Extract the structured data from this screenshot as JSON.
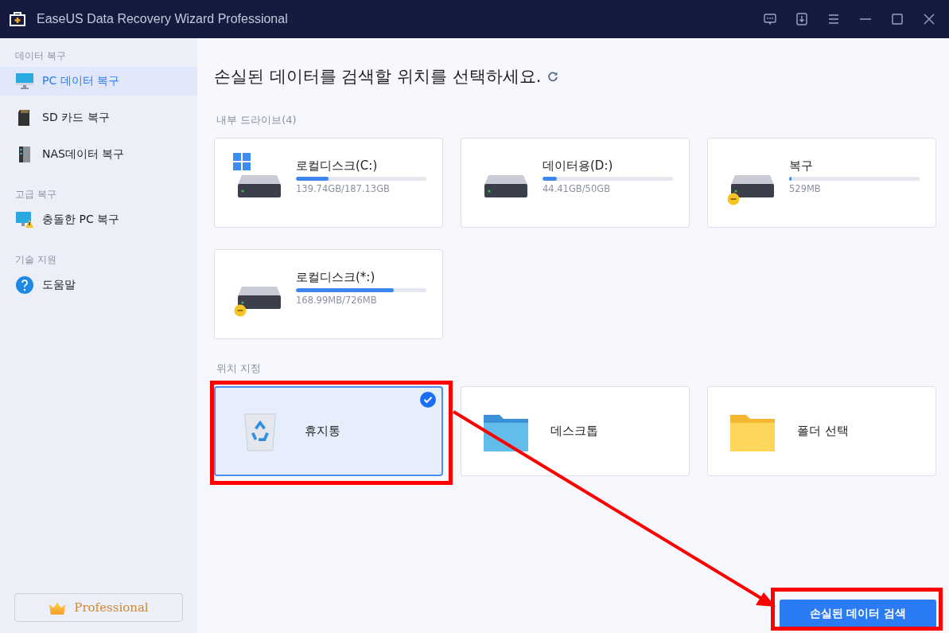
{
  "window": {
    "title": "EaseUS Data Recovery Wizard Professional"
  },
  "sidebar": {
    "sections": [
      {
        "heading": "데이터 복구",
        "items": [
          {
            "label": "PC 데이터 복구",
            "selected": true
          },
          {
            "label": "SD 카드 복구",
            "selected": false
          },
          {
            "label": "NAS데이터 복구",
            "selected": false
          }
        ]
      },
      {
        "heading": "고급 복구",
        "items": [
          {
            "label": "충돌한 PC 복구",
            "selected": false
          }
        ]
      },
      {
        "heading": "기술 지원",
        "items": [
          {
            "label": "도움말",
            "selected": false
          }
        ]
      }
    ],
    "edition_button": "Professional"
  },
  "main": {
    "title": "손실된 데이터를 검색할 위치를 선택하세요.",
    "drives_heading": "내부 드라이브(4)",
    "drives": [
      {
        "name": "로컬디스크(C:)",
        "usage": "139.74GB/187.13GB",
        "level": 0.25,
        "kind": "system"
      },
      {
        "name": "데이터용(D:)",
        "usage": "44.41GB/50GB",
        "level": 0.11,
        "kind": "normal"
      },
      {
        "name": "복구",
        "usage": "529MB",
        "level": 0.02,
        "kind": "unmounted"
      },
      {
        "name": "로컬디스크(*:)",
        "usage": "168.99MB/726MB",
        "level": 0.75,
        "kind": "unmounted"
      }
    ],
    "locations_heading": "위치 지정",
    "locations": [
      {
        "name": "휴지통",
        "kind": "recycle",
        "selected": true
      },
      {
        "name": "데스크톱",
        "kind": "desktop",
        "selected": false
      },
      {
        "name": "폴더 선택",
        "kind": "folder",
        "selected": false
      }
    ],
    "scan_button": "손실된 데이터 검색"
  }
}
